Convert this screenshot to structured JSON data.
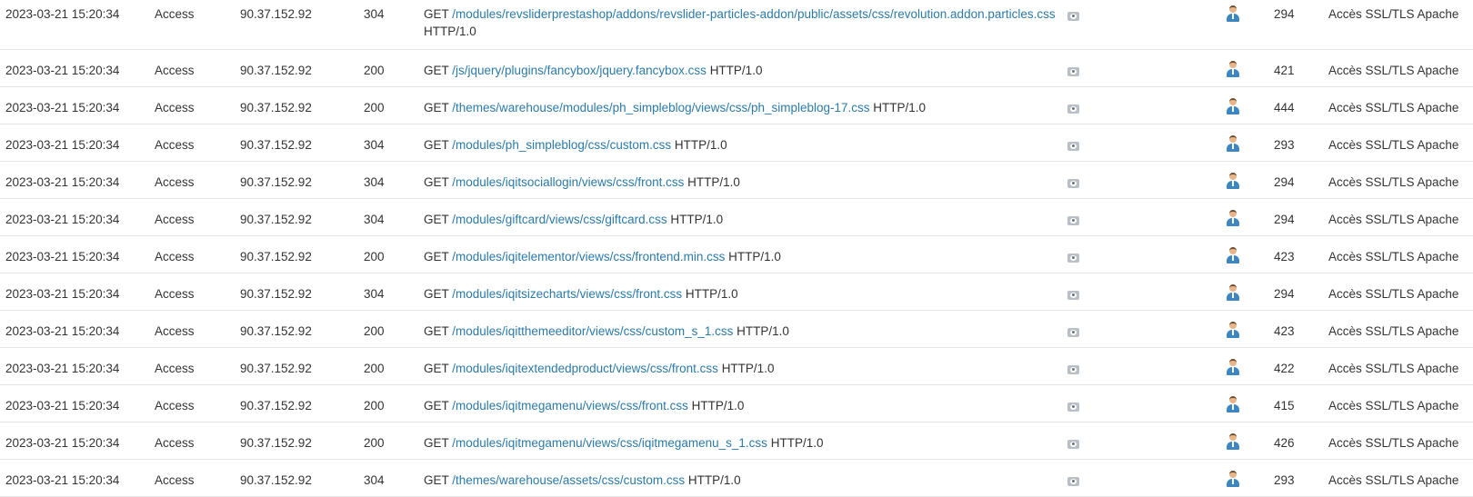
{
  "rows": [
    {
      "date": "2023-03-21 15:20:34",
      "type": "Access",
      "ip": "90.37.152.92",
      "status": "304",
      "method": "GET",
      "path": "/modules/revsliderprestashop/addons/revslider-particles-addon/public/assets/css/revolution.addon.particles.css",
      "protocol": "HTTP/1.0",
      "size": "294",
      "origin": "Accès SSL/TLS Apache"
    },
    {
      "date": "2023-03-21 15:20:34",
      "type": "Access",
      "ip": "90.37.152.92",
      "status": "200",
      "method": "GET",
      "path": "/js/jquery/plugins/fancybox/jquery.fancybox.css",
      "protocol": "HTTP/1.0",
      "size": "421",
      "origin": "Accès SSL/TLS Apache"
    },
    {
      "date": "2023-03-21 15:20:34",
      "type": "Access",
      "ip": "90.37.152.92",
      "status": "200",
      "method": "GET",
      "path": "/themes/warehouse/modules/ph_simpleblog/views/css/ph_simpleblog-17.css",
      "protocol": "HTTP/1.0",
      "size": "444",
      "origin": "Accès SSL/TLS Apache"
    },
    {
      "date": "2023-03-21 15:20:34",
      "type": "Access",
      "ip": "90.37.152.92",
      "status": "304",
      "method": "GET",
      "path": "/modules/ph_simpleblog/css/custom.css",
      "protocol": "HTTP/1.0",
      "size": "293",
      "origin": "Accès SSL/TLS Apache"
    },
    {
      "date": "2023-03-21 15:20:34",
      "type": "Access",
      "ip": "90.37.152.92",
      "status": "304",
      "method": "GET",
      "path": "/modules/iqitsociallogin/views/css/front.css",
      "protocol": "HTTP/1.0",
      "size": "294",
      "origin": "Accès SSL/TLS Apache"
    },
    {
      "date": "2023-03-21 15:20:34",
      "type": "Access",
      "ip": "90.37.152.92",
      "status": "304",
      "method": "GET",
      "path": "/modules/giftcard/views/css/giftcard.css",
      "protocol": "HTTP/1.0",
      "size": "294",
      "origin": "Accès SSL/TLS Apache"
    },
    {
      "date": "2023-03-21 15:20:34",
      "type": "Access",
      "ip": "90.37.152.92",
      "status": "200",
      "method": "GET",
      "path": "/modules/iqitelementor/views/css/frontend.min.css",
      "protocol": "HTTP/1.0",
      "size": "423",
      "origin": "Accès SSL/TLS Apache"
    },
    {
      "date": "2023-03-21 15:20:34",
      "type": "Access",
      "ip": "90.37.152.92",
      "status": "304",
      "method": "GET",
      "path": "/modules/iqitsizecharts/views/css/front.css",
      "protocol": "HTTP/1.0",
      "size": "294",
      "origin": "Accès SSL/TLS Apache"
    },
    {
      "date": "2023-03-21 15:20:34",
      "type": "Access",
      "ip": "90.37.152.92",
      "status": "200",
      "method": "GET",
      "path": "/modules/iqitthemeeditor/views/css/custom_s_1.css",
      "protocol": "HTTP/1.0",
      "size": "423",
      "origin": "Accès SSL/TLS Apache"
    },
    {
      "date": "2023-03-21 15:20:34",
      "type": "Access",
      "ip": "90.37.152.92",
      "status": "200",
      "method": "GET",
      "path": "/modules/iqitextendedproduct/views/css/front.css",
      "protocol": "HTTP/1.0",
      "size": "422",
      "origin": "Accès SSL/TLS Apache"
    },
    {
      "date": "2023-03-21 15:20:34",
      "type": "Access",
      "ip": "90.37.152.92",
      "status": "200",
      "method": "GET",
      "path": "/modules/iqitmegamenu/views/css/front.css",
      "protocol": "HTTP/1.0",
      "size": "415",
      "origin": "Accès SSL/TLS Apache"
    },
    {
      "date": "2023-03-21 15:20:34",
      "type": "Access",
      "ip": "90.37.152.92",
      "status": "200",
      "method": "GET",
      "path": "/modules/iqitmegamenu/views/css/iqitmegamenu_s_1.css",
      "protocol": "HTTP/1.0",
      "size": "426",
      "origin": "Accès SSL/TLS Apache"
    },
    {
      "date": "2023-03-21 15:20:34",
      "type": "Access",
      "ip": "90.37.152.92",
      "status": "304",
      "method": "GET",
      "path": "/themes/warehouse/assets/css/custom.css",
      "protocol": "HTTP/1.0",
      "size": "293",
      "origin": "Accès SSL/TLS Apache"
    }
  ],
  "icons": {
    "view": "eye-icon",
    "user": "user-icon"
  },
  "colors": {
    "link": "#2b7aa8",
    "text": "#333333",
    "divider": "#e4e4e4"
  }
}
